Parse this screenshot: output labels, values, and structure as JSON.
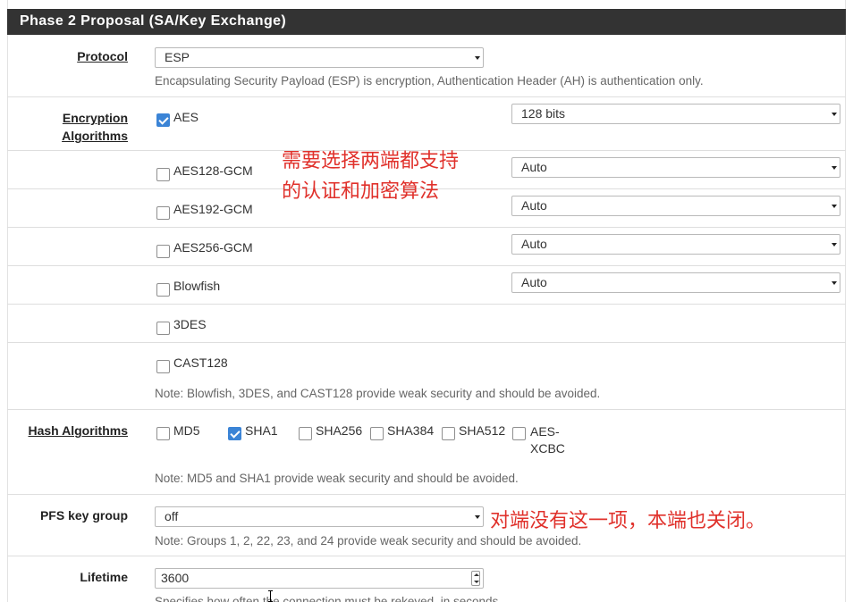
{
  "section": {
    "title": "Phase 2 Proposal (SA/Key Exchange)"
  },
  "protocol": {
    "label": "Protocol",
    "value": "ESP",
    "help": "Encapsulating Security Payload (ESP) is encryption, Authentication Header (AH) is authentication only."
  },
  "encryption": {
    "label_line1": "Encryption",
    "label_line2": "Algorithms",
    "algorithms": [
      {
        "name": "AES",
        "checked": true,
        "keylen": "128 bits"
      },
      {
        "name": "AES128-GCM",
        "checked": false,
        "keylen": "Auto"
      },
      {
        "name": "AES192-GCM",
        "checked": false,
        "keylen": "Auto"
      },
      {
        "name": "AES256-GCM",
        "checked": false,
        "keylen": "Auto"
      },
      {
        "name": "Blowfish",
        "checked": false,
        "keylen": "Auto"
      },
      {
        "name": "3DES",
        "checked": false
      },
      {
        "name": "CAST128",
        "checked": false
      }
    ],
    "note": "Note: Blowfish, 3DES, and CAST128 provide weak security and should be avoided."
  },
  "hash": {
    "label": "Hash Algorithms",
    "options": [
      {
        "name": "MD5",
        "checked": false
      },
      {
        "name": "SHA1",
        "checked": true
      },
      {
        "name": "SHA256",
        "checked": false
      },
      {
        "name": "SHA384",
        "checked": false
      },
      {
        "name": "SHA512",
        "checked": false
      },
      {
        "name_line1": "AES-",
        "name_line2": "XCBC",
        "checked": false
      }
    ],
    "note": "Note: MD5 and SHA1 provide weak security and should be avoided."
  },
  "pfs": {
    "label": "PFS key group",
    "value": "off",
    "note": "Note: Groups 1, 2, 22, 23, and 24 provide weak security and should be avoided."
  },
  "lifetime": {
    "label": "Lifetime",
    "value": "3600",
    "help": "Specifies how often the connection must be rekeyed, in seconds."
  },
  "annotations": {
    "encryption_line1": "需要选择两端都支持",
    "encryption_line2": "的认证和加密算法",
    "pfs": "对端没有这一项，本端也关闭。"
  },
  "colors": {
    "heading_bg": "#333333",
    "checkbox_checked": "#3b84d6",
    "annotation": "#e0312b"
  }
}
